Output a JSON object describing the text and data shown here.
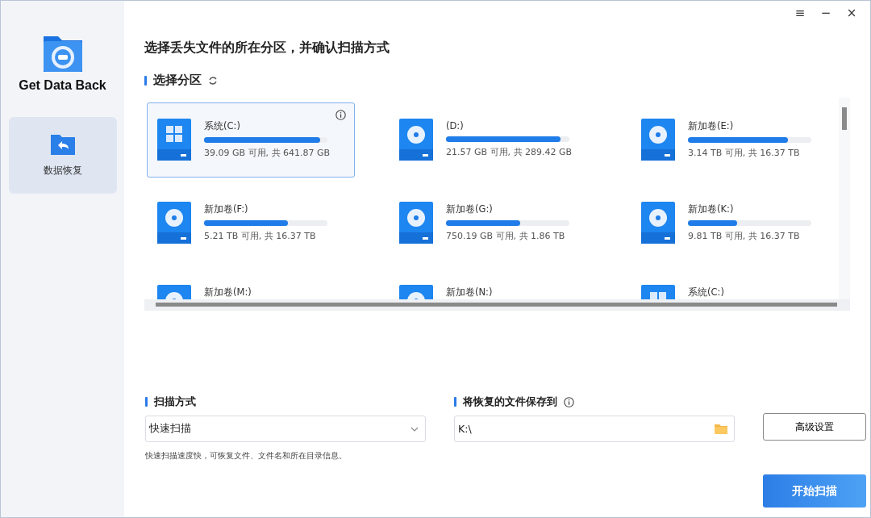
{
  "app": {
    "name": "Get Data Back"
  },
  "sidebar": {
    "items": [
      {
        "label": "数据恢复",
        "selected": true
      }
    ]
  },
  "window_controls": [
    "≡",
    "−",
    "×"
  ],
  "heading": "选择丢失文件的所在分区，并确认扫描方式",
  "partitions": {
    "title": "选择分区",
    "drives": [
      {
        "kind": "windows",
        "name": "系统(C:)",
        "info": "39.09 GB 可用, 共 641.87 GB",
        "level": 0.94,
        "selected": true
      },
      {
        "kind": "disk",
        "name": "(D:)",
        "info": "21.57 GB 可用, 共 289.42 GB",
        "level": 0.925,
        "selected": false
      },
      {
        "kind": "disk",
        "name": "新加卷(E:)",
        "info": "3.14 TB 可用, 共 16.37 TB",
        "level": 0.81,
        "selected": false
      },
      {
        "kind": "disk",
        "name": "新加卷(F:)",
        "info": "5.21 TB 可用, 共 16.37 TB",
        "level": 0.68,
        "selected": false
      },
      {
        "kind": "disk",
        "name": "新加卷(G:)",
        "info": "750.19 GB 可用, 共 1.86 TB",
        "level": 0.6,
        "selected": false
      },
      {
        "kind": "disk",
        "name": "新加卷(K:)",
        "info": "9.81 TB 可用, 共 16.37 TB",
        "level": 0.4,
        "selected": false
      },
      {
        "kind": "disk",
        "name": "新加卷(M:)",
        "selected": false
      },
      {
        "kind": "disk",
        "name": "新加卷(N:)",
        "selected": false
      },
      {
        "kind": "windows",
        "name": "系统(C:)",
        "selected": false
      }
    ]
  },
  "scan_mode": {
    "title": "扫描方式",
    "value": "快速扫描",
    "hint": "快速扫描速度快，可恢复文件、文件名和所在目录信息。"
  },
  "save_to": {
    "title": "将恢复的文件保存到",
    "value": "K:\\"
  },
  "buttons": {
    "advanced": "高级设置",
    "start": "开始扫描"
  }
}
